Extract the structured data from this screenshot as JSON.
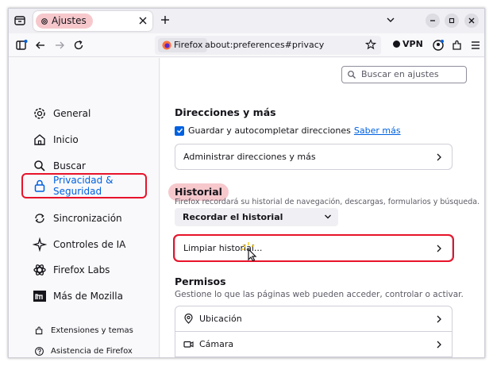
{
  "tab": {
    "title": "Ajustes"
  },
  "urlbar": {
    "identity": "Firefox",
    "url": "about:preferences#privacy"
  },
  "toolbar": {
    "vpn_label": "VPN"
  },
  "search": {
    "placeholder": "Buscar en ajustes"
  },
  "sidebar": {
    "items": [
      {
        "label": "General",
        "icon": "gear-icon"
      },
      {
        "label": "Inicio",
        "icon": "home-icon"
      },
      {
        "label": "Buscar",
        "icon": "search-icon"
      },
      {
        "label": "Privacidad & Seguridad",
        "icon": "lock-icon",
        "selected": true
      },
      {
        "label": "Sincronización",
        "icon": "sync-icon"
      },
      {
        "label": "Controles de IA",
        "icon": "sparkle-icon"
      },
      {
        "label": "Firefox Labs",
        "icon": "labs-icon"
      },
      {
        "label": "Más de Mozilla",
        "icon": "mozilla-icon"
      }
    ],
    "footer": [
      {
        "label": "Extensiones y temas",
        "icon": "puzzle-icon"
      },
      {
        "label": "Asistencia de Firefox",
        "icon": "help-icon"
      }
    ]
  },
  "addresses": {
    "heading": "Direcciones y más",
    "checkbox_label": "Guardar y autocompletar direcciones",
    "checkbox_checked": true,
    "learn_more": "Saber más",
    "manage_label": "Administrar direcciones y más"
  },
  "history": {
    "heading": "Historial",
    "description": "Firefox recordará su historial de navegación, descargas, formularios y búsqueda.",
    "mode": "Recordar el historial",
    "clear_label": "Limpiar historial..."
  },
  "permissions": {
    "heading": "Permisos",
    "description": "Gestione lo que las páginas web pueden acceder, controlar o activar.",
    "items": [
      {
        "label": "Ubicación",
        "icon": "location-icon"
      },
      {
        "label": "Cámara",
        "icon": "camera-icon"
      }
    ]
  },
  "colors": {
    "accent": "#0061e0",
    "highlight": "#e8132a",
    "pill": "#f6c8cc"
  }
}
